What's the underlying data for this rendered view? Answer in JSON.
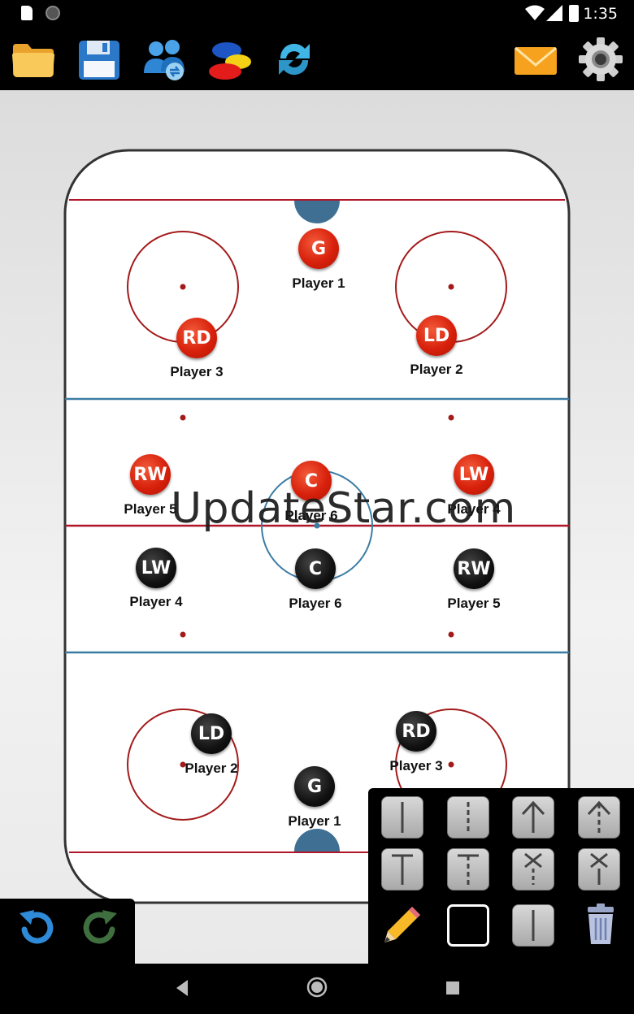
{
  "status_bar": {
    "time": "1:35"
  },
  "toolbar": {
    "buttons": [
      {
        "icon": "folder-icon"
      },
      {
        "icon": "save-icon"
      },
      {
        "icon": "team-swap-icon"
      },
      {
        "icon": "cones-icon"
      },
      {
        "icon": "refresh-icon"
      },
      {
        "icon": "email-icon"
      },
      {
        "icon": "settings-icon"
      }
    ]
  },
  "watermark": "UpdateStar.com",
  "players": [
    {
      "id": "red-g",
      "team": "red",
      "pos": "G",
      "label": "Player 1"
    },
    {
      "id": "red-rd",
      "team": "red",
      "pos": "RD",
      "label": "Player 3"
    },
    {
      "id": "red-ld",
      "team": "red",
      "pos": "LD",
      "label": "Player 2"
    },
    {
      "id": "red-rw",
      "team": "red",
      "pos": "RW",
      "label": "Player 5"
    },
    {
      "id": "red-c",
      "team": "red",
      "pos": "C",
      "label": "Player 6"
    },
    {
      "id": "red-lw",
      "team": "red",
      "pos": "LW",
      "label": "Player 4"
    },
    {
      "id": "black-lw",
      "team": "black",
      "pos": "LW",
      "label": "Player 4"
    },
    {
      "id": "black-c",
      "team": "black",
      "pos": "C",
      "label": "Player 6"
    },
    {
      "id": "black-rw",
      "team": "black",
      "pos": "RW",
      "label": "Player 5"
    },
    {
      "id": "black-ld",
      "team": "black",
      "pos": "LD",
      "label": "Player 2"
    },
    {
      "id": "black-rd",
      "team": "black",
      "pos": "RD",
      "label": "Player 3"
    },
    {
      "id": "black-g",
      "team": "black",
      "pos": "G",
      "label": "Player 1"
    }
  ],
  "colors": {
    "red_line": "#b0162a",
    "blue_line": "#3c7ca3",
    "crease": "#3f6f93",
    "team_red": "#d8210c",
    "team_black": "#111111"
  },
  "drawing_tools": [
    {
      "icon": "solid-line-icon"
    },
    {
      "icon": "dashed-line-icon"
    },
    {
      "icon": "arrow-line-icon"
    },
    {
      "icon": "dashed-arrow-icon"
    },
    {
      "icon": "t-line-icon"
    },
    {
      "icon": "dashed-t-line-icon"
    },
    {
      "icon": "x-arrow-icon"
    },
    {
      "icon": "x-line-icon"
    },
    {
      "icon": "pencil-icon"
    },
    {
      "icon": "rectangle-icon"
    },
    {
      "icon": "line-style-icon"
    },
    {
      "icon": "trash-icon"
    }
  ],
  "history": [
    {
      "icon": "undo-icon"
    },
    {
      "icon": "redo-icon"
    }
  ],
  "nav": [
    {
      "icon": "back-icon"
    },
    {
      "icon": "home-icon"
    },
    {
      "icon": "recents-icon"
    }
  ]
}
